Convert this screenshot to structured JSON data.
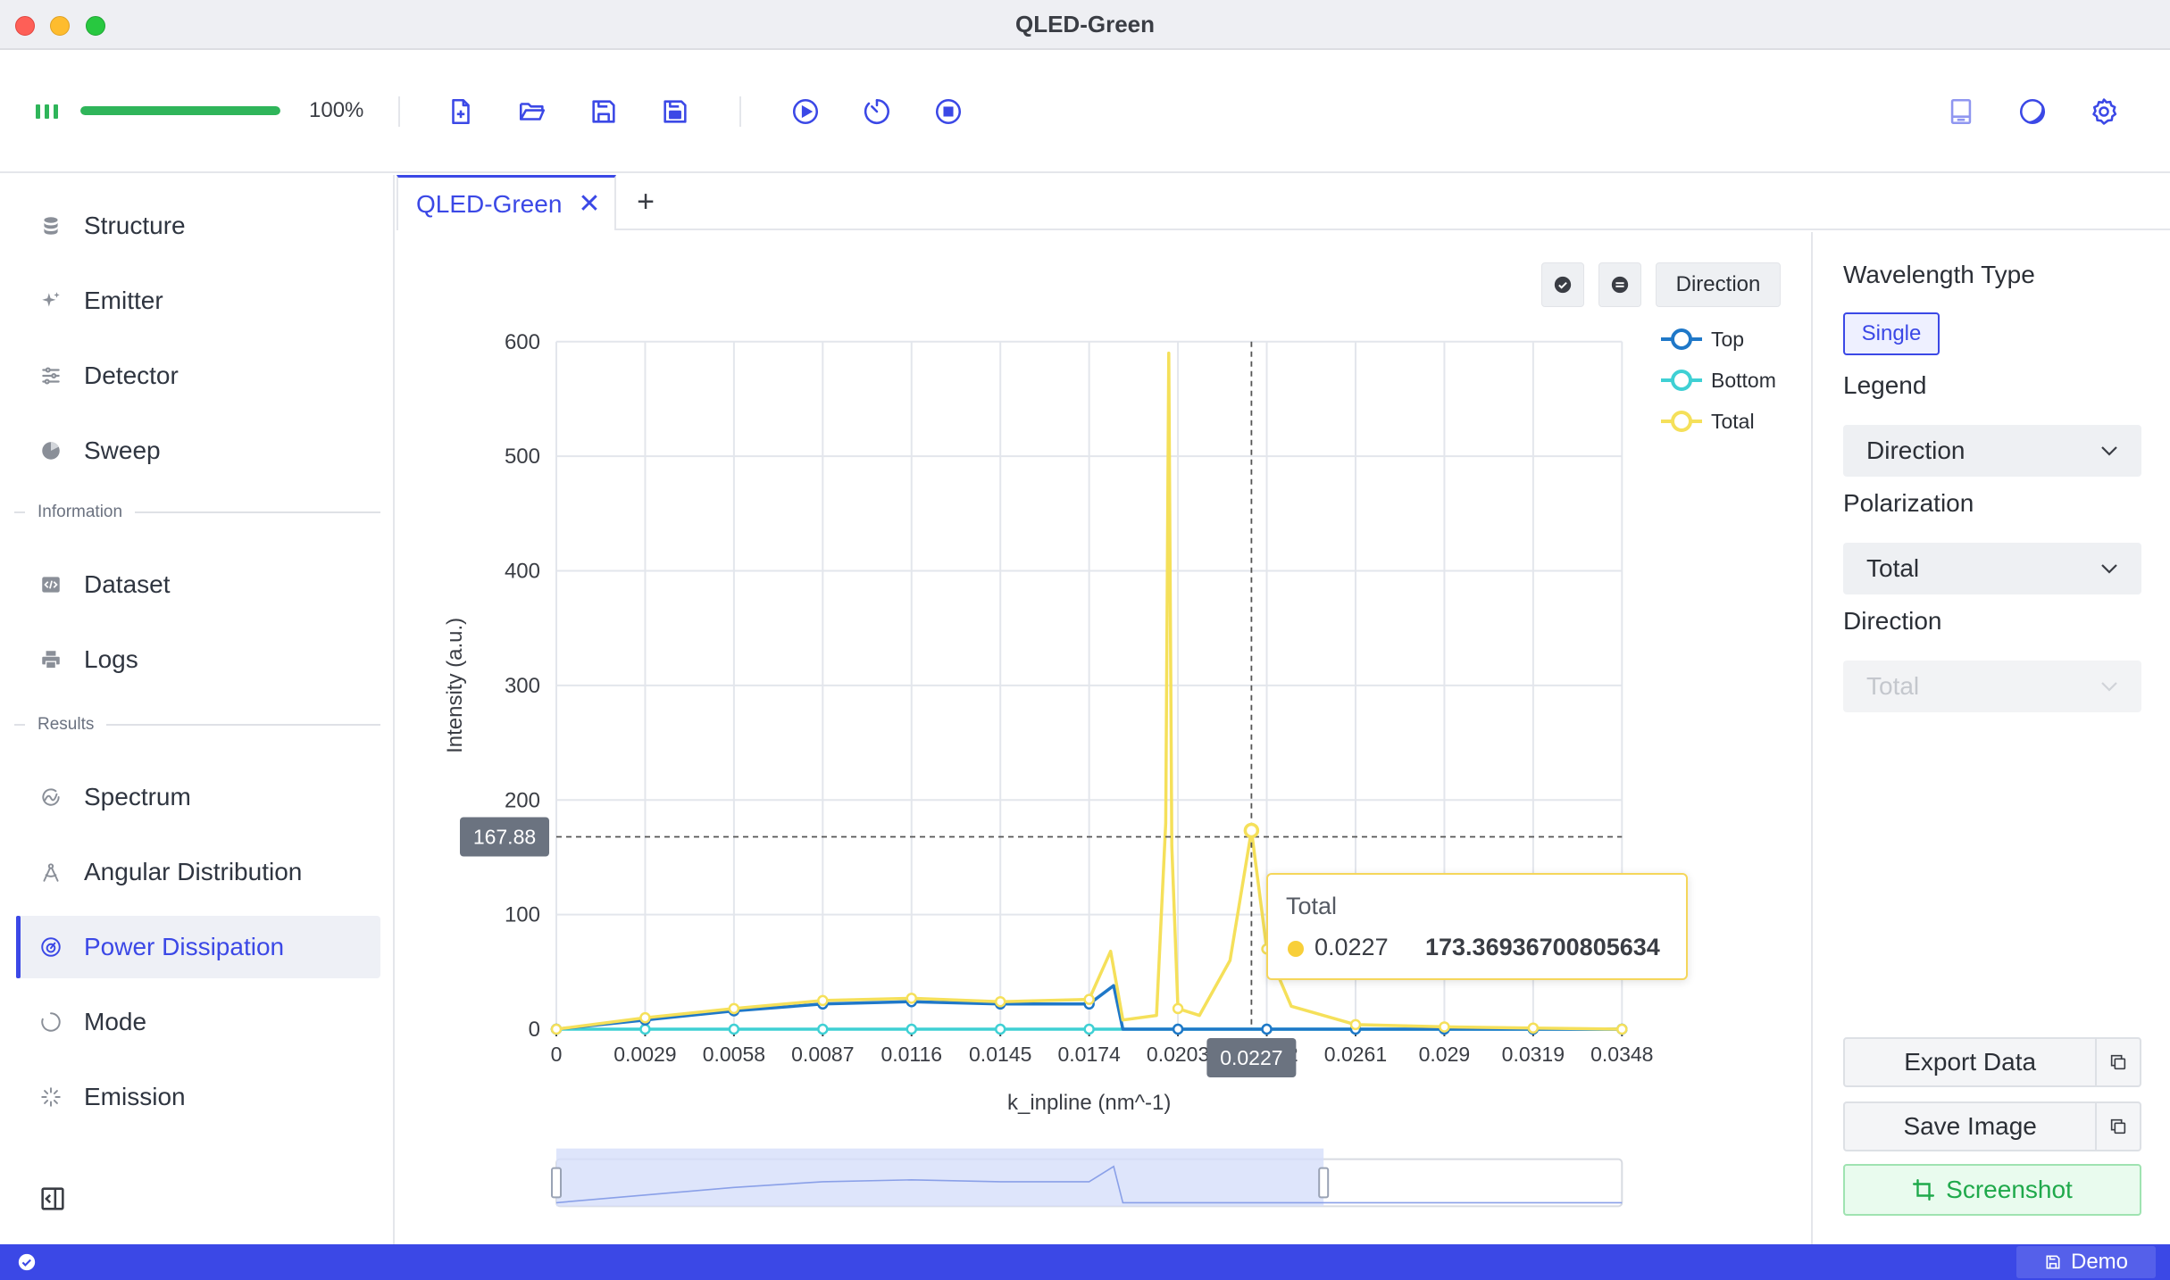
{
  "window": {
    "title": "QLED-Green"
  },
  "toolbar": {
    "progress": {
      "value": 1.0,
      "label": "100%"
    },
    "buttons": [
      "new-file-icon",
      "open-folder-icon",
      "save-icon",
      "save-as-icon",
      "run-icon",
      "timer-icon",
      "stop-icon",
      "book-icon",
      "theme-icon",
      "settings-icon"
    ]
  },
  "sidebar": {
    "items": [
      {
        "label": "Structure",
        "icon": "database-icon"
      },
      {
        "label": "Emitter",
        "icon": "sparkle-icon"
      },
      {
        "label": "Detector",
        "icon": "sliders-icon"
      },
      {
        "label": "Sweep",
        "icon": "pie-icon"
      }
    ],
    "section_information": "Information",
    "info_items": [
      {
        "label": "Dataset",
        "icon": "code-icon"
      },
      {
        "label": "Logs",
        "icon": "printer-icon"
      }
    ],
    "section_results": "Results",
    "result_items": [
      {
        "label": "Spectrum",
        "icon": "spectrum-icon"
      },
      {
        "label": "Angular Distribution",
        "icon": "compass-icon"
      },
      {
        "label": "Power Dissipation",
        "icon": "gauge-icon",
        "active": true
      },
      {
        "label": "Mode",
        "icon": "loader-circle-icon"
      },
      {
        "label": "Emission",
        "icon": "loader-rays-icon"
      }
    ]
  },
  "tabs": [
    {
      "label": "QLED-Green",
      "close": "✕"
    }
  ],
  "tab_add": "+",
  "chart_controls": {
    "direction_label": "Direction"
  },
  "chart_data": {
    "type": "line",
    "xlabel": "k_inpline (nm^-1)",
    "ylabel": "Intensity (a.u.)",
    "ylim": [
      0,
      600
    ],
    "xlim": [
      0,
      0.0348
    ],
    "x_ticks": [
      "0",
      "0.0029",
      "0.0058",
      "0.0087",
      "0.0116",
      "0.0145",
      "0.0174",
      "0.0203",
      "0.0232",
      "0.0261",
      "0.029",
      "0.0319",
      "0.0348"
    ],
    "y_ticks": [
      "0",
      "100",
      "200",
      "300",
      "400",
      "500",
      "600"
    ],
    "grid": true,
    "legend_position": "top-right",
    "colors": {
      "Top": "#1f78c8",
      "Bottom": "#3fd0d4",
      "Total": "#f5e05a"
    },
    "series": [
      {
        "name": "Top",
        "x": [
          0,
          0.0029,
          0.0058,
          0.0087,
          0.0116,
          0.0145,
          0.0174,
          0.0182,
          0.0185,
          0.0203,
          0.0232,
          0.0261,
          0.029,
          0.0319,
          0.0348
        ],
        "values": [
          0,
          8,
          16,
          22,
          24,
          22,
          22,
          38,
          0,
          0,
          0,
          0,
          0,
          0,
          0
        ]
      },
      {
        "name": "Bottom",
        "x": [
          0,
          0.0029,
          0.0058,
          0.0087,
          0.0116,
          0.0145,
          0.0174,
          0.0203,
          0.0227,
          0.0232,
          0.0261,
          0.029,
          0.0319,
          0.0348
        ],
        "values": [
          0,
          0,
          0,
          0,
          0,
          0,
          0,
          0,
          0,
          0,
          0,
          0,
          0,
          0
        ]
      },
      {
        "name": "Total",
        "x": [
          0,
          0.0029,
          0.0058,
          0.0087,
          0.0116,
          0.0145,
          0.0174,
          0.0181,
          0.0185,
          0.0196,
          0.0199,
          0.02,
          0.0201,
          0.0203,
          0.021,
          0.022,
          0.0227,
          0.0232,
          0.024,
          0.0261,
          0.029,
          0.0319,
          0.0348
        ],
        "values": [
          0,
          10,
          18,
          25,
          27,
          24,
          26,
          68,
          8,
          12,
          180,
          590,
          160,
          18,
          12,
          60,
          173.37,
          70,
          20,
          4,
          2,
          1,
          0
        ]
      }
    ],
    "crosshair": {
      "x_label": "0.0227",
      "y_label": "167.88"
    },
    "tooltip": {
      "title": "Total",
      "x": "0.0227",
      "y": "173.36936700805634"
    },
    "zoom_range": [
      0,
      0.72
    ]
  },
  "right_panel": {
    "wavelength_type_label": "Wavelength Type",
    "wavelength_type_value": "Single",
    "legend_label": "Legend",
    "legend_value": "Direction",
    "polarization_label": "Polarization",
    "polarization_value": "Total",
    "direction_label": "Direction",
    "direction_value": "Total",
    "export_label": "Export Data",
    "save_image_label": "Save Image",
    "screenshot_label": "Screenshot"
  },
  "statusbar": {
    "demo_label": "Demo"
  }
}
